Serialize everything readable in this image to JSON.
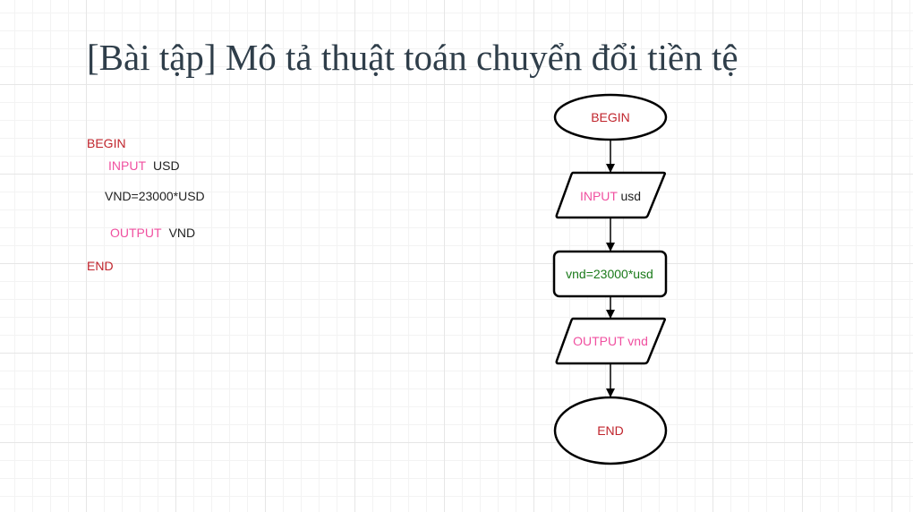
{
  "title": "[Bài tập] Mô tả thuật toán chuyển đổi tiền tệ",
  "pseudocode": {
    "begin": "BEGIN",
    "input_keyword": "INPUT",
    "input_var": "USD",
    "assignment": "VND=23000*USD",
    "output_keyword": "OUTPUT",
    "output_var": "VND",
    "end": "END"
  },
  "flowchart": {
    "begin": "BEGIN",
    "input_keyword": "INPUT",
    "input_var": "usd",
    "process": "vnd=23000*usd",
    "output": "OUTPUT vnd",
    "end": "END"
  },
  "colors": {
    "keyword_red": "#c0242c",
    "keyword_pink": "#f050a0",
    "process_green": "#1a7a1a",
    "title": "#2f3e4a"
  }
}
